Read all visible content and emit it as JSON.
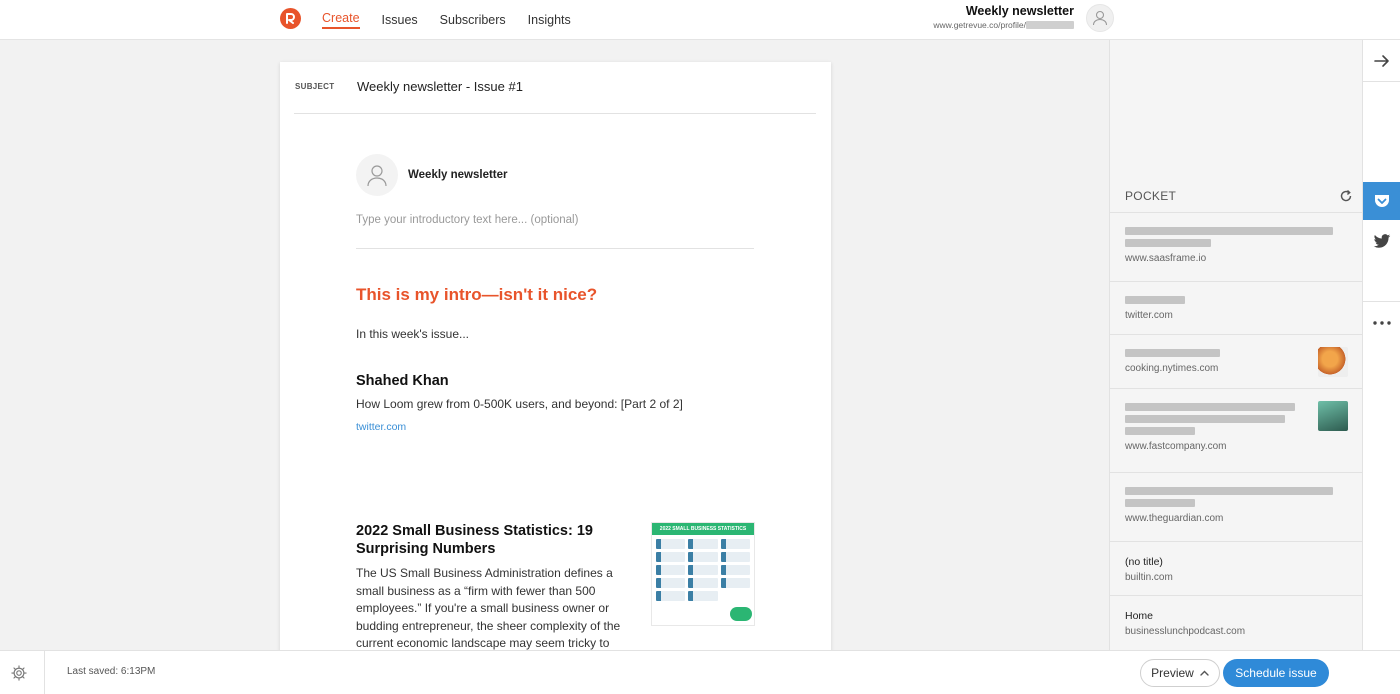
{
  "nav": {
    "items": [
      {
        "label": "Create",
        "active": true
      },
      {
        "label": "Issues",
        "active": false
      },
      {
        "label": "Subscribers",
        "active": false
      },
      {
        "label": "Insights",
        "active": false
      }
    ]
  },
  "profile": {
    "name": "Weekly newsletter",
    "url_prefix": "www.getrevue.co/profile/"
  },
  "editor": {
    "subject_label": "SUBJECT",
    "subject_value": "Weekly newsletter - Issue #1",
    "author_name": "Weekly newsletter",
    "intro_placeholder": "Type your introductory text here... (optional)",
    "intro_heading": "This is my intro—isn't it nice?",
    "issue_text": "In this week's issue...",
    "item1": {
      "title": "Shahed Khan",
      "description": "How Loom grew from 0-500K users, and beyond: [Part 2 of 2]",
      "link": "twitter.com"
    },
    "item2": {
      "title": "2022 Small Business Statistics: 19 Surprising Numbers",
      "body": "The US Small Business Administration defines a small business as a “firm with fewer than 500 employees.” If you're a small business owner or budding entrepreneur, the sheer complexity of the current economic landscape may seem tricky to",
      "thumb_caption": "2022 SMALL BUSINESS STATISTICS"
    }
  },
  "panel": {
    "title": "POCKET",
    "items": [
      {
        "domain": "www.saasframe.io"
      },
      {
        "domain": "twitter.com"
      },
      {
        "domain": "cooking.nytimes.com"
      },
      {
        "domain": "www.fastcompany.com"
      },
      {
        "domain": "www.theguardian.com"
      },
      {
        "title": "(no title)",
        "domain": "builtin.com"
      },
      {
        "title": "Home",
        "domain": "businesslunchpodcast.com"
      }
    ]
  },
  "footer": {
    "last_saved": "Last saved: 6:13PM",
    "preview_label": "Preview",
    "schedule_label": "Schedule issue"
  },
  "colors": {
    "brand": "#e8542b",
    "accent_blue": "#2f8ad8"
  },
  "icons": [
    "revue-logo-icon",
    "user-icon",
    "refresh-icon",
    "arrow-right-icon",
    "pocket-icon",
    "twitter-icon",
    "more-icon",
    "gear-icon",
    "chevron-up-icon"
  ]
}
